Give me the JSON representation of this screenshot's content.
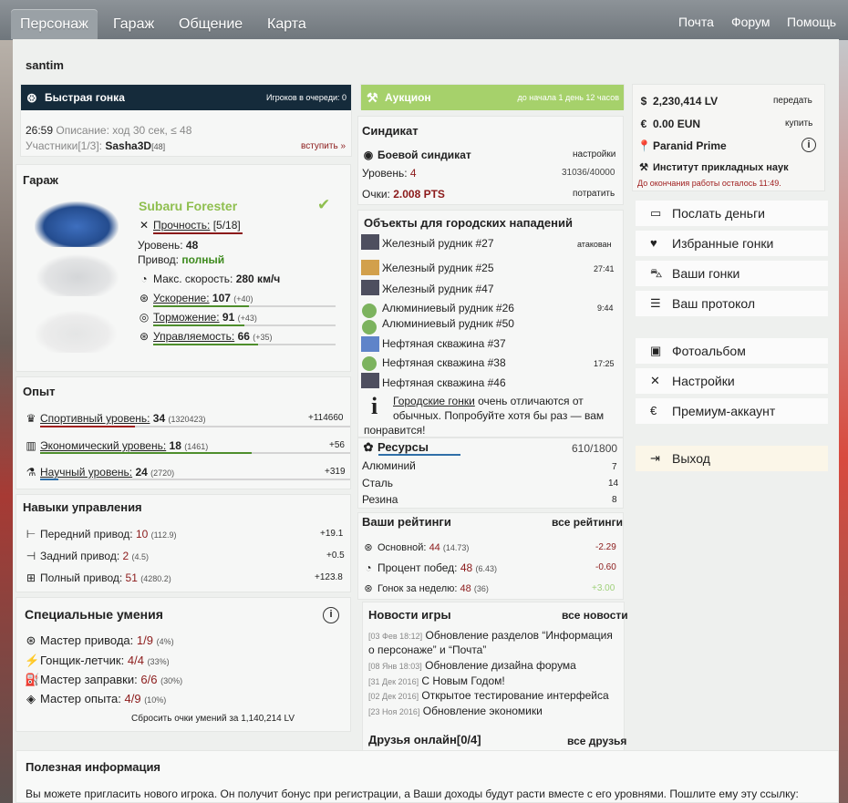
{
  "topnav": {
    "tabs": [
      "Персонаж",
      "Гараж",
      "Общение",
      "Карта"
    ],
    "right": [
      "Почта",
      "Форум",
      "Помощь"
    ]
  },
  "username": "santim",
  "quickrace": {
    "title": "Быстрая гонка",
    "queue": "Игроков в очереди: 0",
    "time": "26:59",
    "desc": "Описание: ход 30 сек, ≤ 48",
    "participants_label": "Участники[1/3]:",
    "participant": "Sasha3D",
    "participant_level": "[48]",
    "join": "вступить »"
  },
  "auction": {
    "title": "Аукцион",
    "until": "до начала 1 день 12 часов"
  },
  "money": {
    "lv": "2,230,414 LV",
    "transfer": "передать",
    "eun": "0.00 EUN",
    "buy": "купить",
    "car": "Paranid Prime",
    "institute": "Институт прикладных наук",
    "closing": "До окончания работы осталось 11:49."
  },
  "garage": {
    "title": "Гараж",
    "car_name": "Subaru Forester",
    "durability_label": "Прочность:",
    "durability": "[5/18]",
    "level_label": "Уровень:",
    "level": "48",
    "drive_label": "Привод:",
    "drive": "полный",
    "speed_label": "Макс. скорость:",
    "speed": "280 км/ч",
    "accel_label": "Ускорение:",
    "accel": "107",
    "accel_bonus": "(+40)",
    "brake_label": "Торможение:",
    "brake": "91",
    "brake_bonus": "(+43)",
    "handling_label": "Управляемость:",
    "handling": "66",
    "handling_bonus": "(+35)"
  },
  "syndicate": {
    "title": "Синдикат",
    "name": "Боевой синдикат",
    "settings": "настройки",
    "level_label": "Уровень:",
    "level": "4",
    "progress": "31036/40000",
    "points_label": "Очки:",
    "points": "2.008 PTS",
    "spend": "потратить"
  },
  "targets": {
    "title": "Объекты для городских нападений",
    "items": [
      {
        "name": "Железный рудник #27",
        "status": "атакован"
      },
      {
        "name": "Железный рудник #25",
        "status": "27:41"
      },
      {
        "name": "Железный рудник #47",
        "status": ""
      },
      {
        "name": "Алюминиевый рудник #26",
        "status": "9:44"
      },
      {
        "name": "Алюминиевый рудник #50",
        "status": ""
      },
      {
        "name": "Нефтяная скважина #37",
        "status": ""
      },
      {
        "name": "Нефтяная скважина #38",
        "status": "17:25"
      },
      {
        "name": "Нефтяная скважина #46",
        "status": ""
      }
    ],
    "info_link": "Городские гонки",
    "info_rest": " очень отличаются от",
    "info_line2": "обычных. Попробуйте хотя бы раз — вам",
    "info_line3": "понравится!"
  },
  "resources": {
    "title": "Ресурсы",
    "total": "610/1800",
    "items": [
      {
        "name": "Алюминий",
        "value": "7"
      },
      {
        "name": "Сталь",
        "value": "14"
      },
      {
        "name": "Резина",
        "value": "8"
      }
    ]
  },
  "ratings": {
    "title": "Ваши рейтинги",
    "all": "все рейтинги",
    "items": [
      {
        "label": "Основной:",
        "value": "44",
        "sub": "(14.73)",
        "delta": "-2.29"
      },
      {
        "label": "Процент побед:",
        "value": "48",
        "sub": "(6.43)",
        "delta": "-0.60"
      },
      {
        "label": "Гонок за неделю:",
        "value": "48",
        "sub": "(36)",
        "delta": "+3.00"
      }
    ]
  },
  "menu": [
    {
      "label": "Послать деньги",
      "icon": "money-icon"
    },
    {
      "label": "Избранные гонки",
      "icon": "heart-icon"
    },
    {
      "label": "Ваши гонки",
      "icon": "car-icon"
    },
    {
      "label": "Ваш протокол",
      "icon": "document-icon"
    },
    {
      "label": "Фотоальбом",
      "icon": "camera-icon"
    },
    {
      "label": "Настройки",
      "icon": "tools-icon"
    },
    {
      "label": "Премиум-аккаунт",
      "icon": "euro-icon"
    },
    {
      "label": "Выход",
      "icon": "exit-icon"
    }
  ],
  "experience": {
    "title": "Опыт",
    "items": [
      {
        "label": "Спортивный уровень:",
        "value": "34",
        "sub": "(1320423)",
        "delta": "+114660"
      },
      {
        "label": "Экономический уровень:",
        "value": "18",
        "sub": "(1461)",
        "delta": "+56"
      },
      {
        "label": "Научный уровень:",
        "value": "24",
        "sub": "(2720)",
        "delta": "+319"
      }
    ]
  },
  "skills": {
    "title": "Навыки управления",
    "items": [
      {
        "label": "Передний привод:",
        "value": "10",
        "sub": "(112.9)",
        "delta": "+19.1"
      },
      {
        "label": "Задний привод:",
        "value": "2",
        "sub": "(4.5)",
        "delta": "+0.5"
      },
      {
        "label": "Полный привод:",
        "value": "51",
        "sub": "(4280.2)",
        "delta": "+123.8"
      }
    ]
  },
  "special": {
    "title": "Специальные умения",
    "items": [
      {
        "label": "Мастер привода:",
        "value": "1/9",
        "sub": "(4%)"
      },
      {
        "label": "Гонщик-летчик:",
        "value": "4/4",
        "sub": "(33%)"
      },
      {
        "label": "Мастер заправки:",
        "value": "6/6",
        "sub": "(30%)"
      },
      {
        "label": "Мастер опыта:",
        "value": "4/9",
        "sub": "(10%)"
      }
    ],
    "reset": "Сбросить очки умений за 1,140,214 LV"
  },
  "news": {
    "title": "Новости игры",
    "all": "все новости",
    "items": [
      {
        "date": "[03 Фев 18:12]",
        "text": "Обновление разделов “Информация",
        "text2": "о персонаже” и “Почта”"
      },
      {
        "date": "[08 Янв 18:03]",
        "text": "Обновление дизайна форума",
        "text2": ""
      },
      {
        "date": "[31 Дек 2016]",
        "text": "С Новым Годом!",
        "text2": ""
      },
      {
        "date": "[02 Дек 2016]",
        "text": "Открытое тестирование интерфейса",
        "text2": ""
      },
      {
        "date": "[23 Ноя 2016]",
        "text": "Обновление экономики",
        "text2": ""
      }
    ]
  },
  "friends": {
    "title": "Друзья онлайн[0/4]",
    "all": "все друзья"
  },
  "useful": {
    "title": "Полезная информация",
    "text": "Вы можете пригласить нового игрока. Он получит бонус при регистрации, а Ваши доходы будут расти вместе с его уровнями. Пошлите ему эту ссылку:"
  }
}
